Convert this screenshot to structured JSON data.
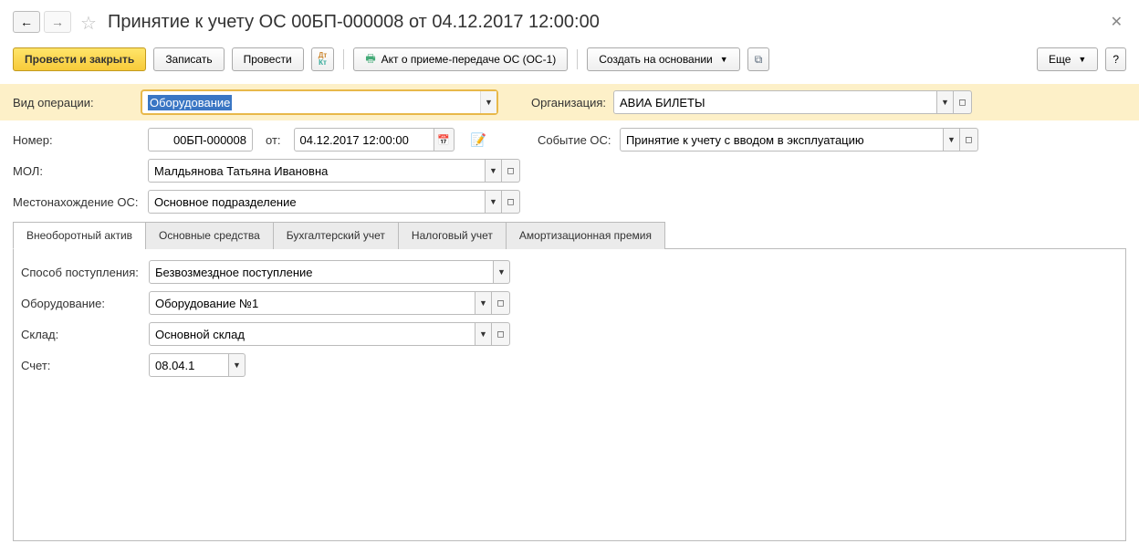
{
  "header": {
    "title": "Принятие к учету ОС 00БП-000008 от 04.12.2017 12:00:00"
  },
  "toolbar": {
    "post_and_close": "Провести и закрыть",
    "save": "Записать",
    "post": "Провести",
    "act": "Акт о приеме-передаче ОС (ОС-1)",
    "create_based": "Создать на основании",
    "more": "Еще",
    "help": "?"
  },
  "fields": {
    "operation_type_label": "Вид операции:",
    "operation_type_value": "Оборудование",
    "org_label": "Организация:",
    "org_value": "АВИА БИЛЕТЫ",
    "number_label": "Номер:",
    "number_value": "00БП-000008",
    "from_label": "от:",
    "date_value": "04.12.2017 12:00:00",
    "event_label": "Событие ОС:",
    "event_value": "Принятие к учету с вводом в эксплуатацию",
    "mol_label": "МОЛ:",
    "mol_value": "Малдьянова Татьяна Ивановна",
    "location_label": "Местонахождение ОС:",
    "location_value": "Основное подразделение"
  },
  "tabs": {
    "t1": "Внеоборотный актив",
    "t2": "Основные средства",
    "t3": "Бухгалтерский учет",
    "t4": "Налоговый учет",
    "t5": "Амортизационная премия"
  },
  "tab1": {
    "receipt_method_label": "Способ поступления:",
    "receipt_method_value": "Безвозмездное поступление",
    "equipment_label": "Оборудование:",
    "equipment_value": "Оборудование №1",
    "warehouse_label": "Склад:",
    "warehouse_value": "Основной склад",
    "account_label": "Счет:",
    "account_value": "08.04.1"
  }
}
